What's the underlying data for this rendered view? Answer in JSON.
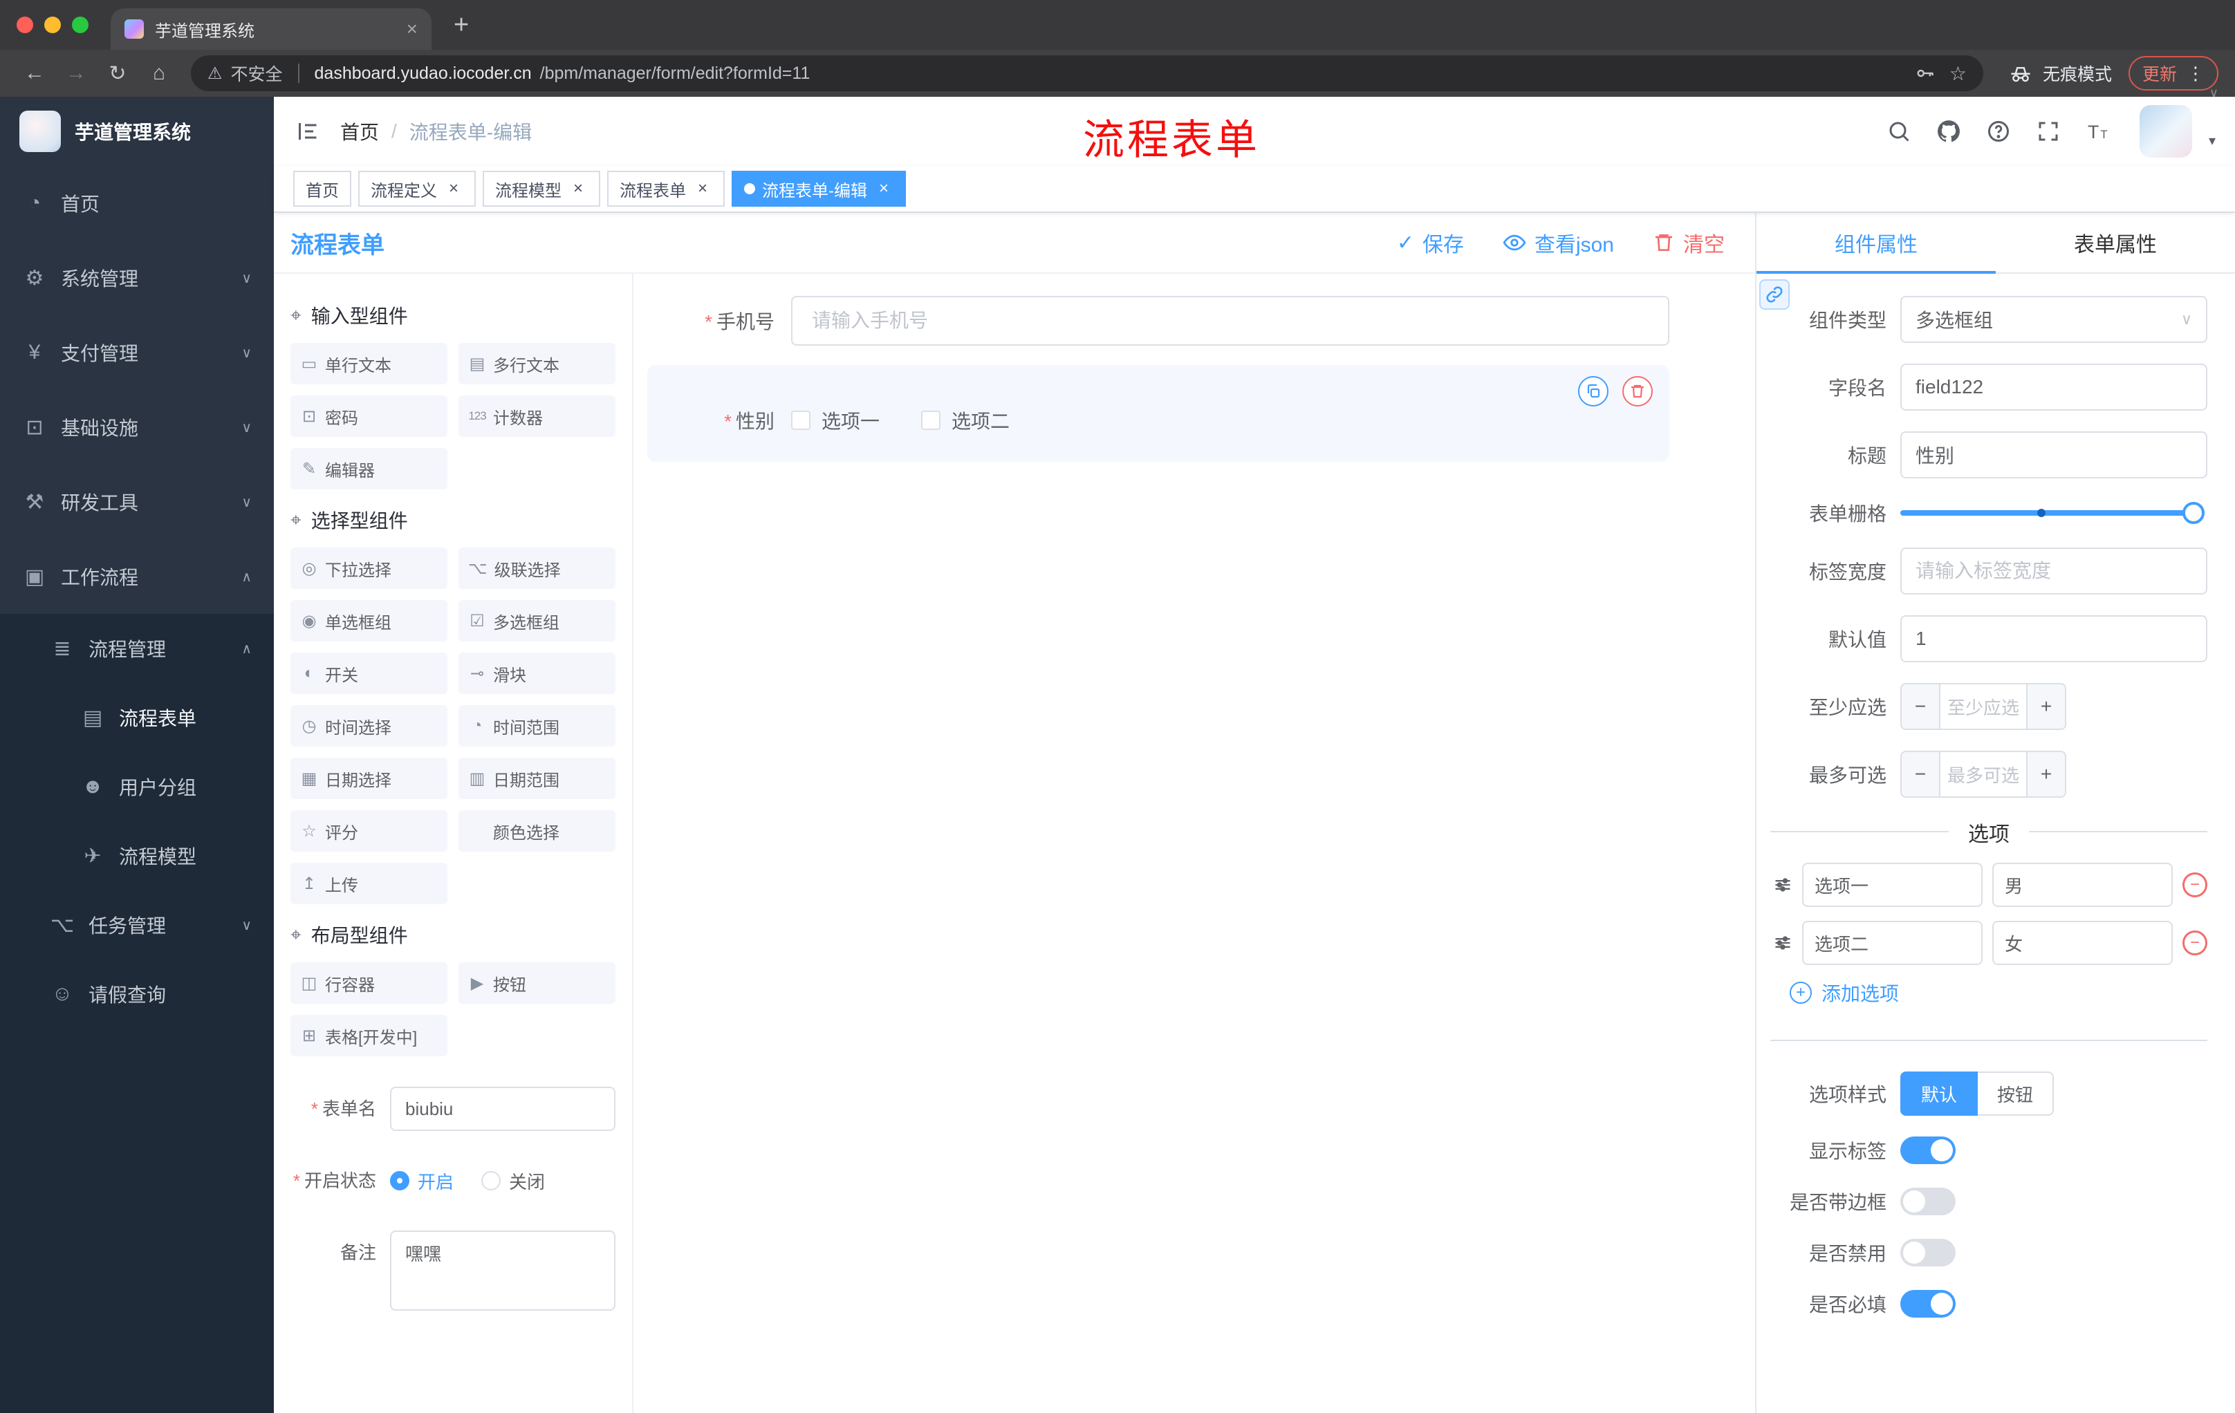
{
  "colors": {
    "accent": "#409eff",
    "danger": "#f56c6c",
    "annotation_red": "#f50f0f",
    "tag_active": "#409eff",
    "sidebar_bg": "#2a3442"
  },
  "misc": {
    "required_star": "*"
  },
  "icons": {
    "close": "×",
    "plus": "+",
    "back": "←",
    "forward": "→",
    "reload": "↻",
    "home": "⌂",
    "warning": "⚠",
    "star": "☆",
    "menu_dots": "⋮",
    "chevron_down": "∨",
    "chevron_up": "∧",
    "caret_down": "▾",
    "check": "✓",
    "minus": "−",
    "group_icon": "⌖"
  },
  "browser": {
    "tab": {
      "title": "芋道管理系统"
    },
    "security_label": "不安全",
    "url_domain": "dashboard.yudao.iocoder.cn",
    "url_path": "/bpm/manager/form/edit?formId=11",
    "incognito_label": "无痕模式",
    "update_label": "更新"
  },
  "sidebar": {
    "logo_title": "芋道管理系统",
    "items": [
      {
        "label": "首页",
        "glyph": "◔",
        "chevron": ""
      },
      {
        "label": "系统管理",
        "glyph": "⚙",
        "chevron": "∨"
      },
      {
        "label": "支付管理",
        "glyph": "¥",
        "chevron": "∨"
      },
      {
        "label": "基础设施",
        "glyph": "⊡",
        "chevron": "∨"
      },
      {
        "label": "研发工具",
        "glyph": "⚒",
        "chevron": "∨"
      },
      {
        "label": "工作流程",
        "glyph": "▣",
        "chevron": "∧"
      }
    ],
    "workflow": {
      "process_mgmt": {
        "label": "流程管理",
        "glyph": "≣",
        "chevron": "∧"
      },
      "children": [
        {
          "label": "流程表单",
          "glyph": "▤"
        },
        {
          "label": "用户分组",
          "glyph": "☻"
        },
        {
          "label": "流程模型",
          "glyph": "✈"
        }
      ],
      "task_mgmt": {
        "label": "任务管理",
        "glyph": "⌥",
        "chevron": "∨"
      },
      "leave_query": {
        "label": "请假查询",
        "glyph": "☺"
      }
    }
  },
  "header": {
    "breadcrumb": {
      "home": "首页",
      "separator": "/",
      "current": "流程表单-编辑"
    },
    "annotation": "流程表单"
  },
  "tags": [
    {
      "label": "首页"
    },
    {
      "label": "流程定义"
    },
    {
      "label": "流程模型"
    },
    {
      "label": "流程表单"
    },
    {
      "label": "流程表单-编辑"
    }
  ],
  "designer": {
    "title": "流程表单",
    "actions": {
      "save": "保存",
      "view_json": "查看json",
      "clear": "清空"
    },
    "palette": {
      "groups": [
        {
          "title": "输入型组件",
          "items": [
            {
              "label": "单行文本",
              "glyph": "▭"
            },
            {
              "label": "多行文本",
              "glyph": "▤"
            },
            {
              "label": "密码",
              "glyph": "⊡"
            },
            {
              "label": "计数器",
              "glyph": "123"
            },
            {
              "label": "编辑器",
              "glyph": "✎"
            }
          ]
        },
        {
          "title": "选择型组件",
          "items": [
            {
              "label": "下拉选择",
              "glyph": "◎"
            },
            {
              "label": "级联选择",
              "glyph": "⌥"
            },
            {
              "label": "单选框组",
              "glyph": "◉"
            },
            {
              "label": "多选框组",
              "glyph": "☑"
            },
            {
              "label": "开关",
              "glyph": "◐"
            },
            {
              "label": "滑块",
              "glyph": "⊸"
            },
            {
              "label": "时间选择",
              "glyph": "◷"
            },
            {
              "label": "时间范围",
              "glyph": "◔"
            },
            {
              "label": "日期选择",
              "glyph": "▦"
            },
            {
              "label": "日期范围",
              "glyph": "▥"
            },
            {
              "label": "评分",
              "glyph": "☆"
            },
            {
              "label": "颜色选择",
              "glyph": "⊚"
            },
            {
              "label": "上传",
              "glyph": "↥"
            }
          ]
        },
        {
          "title": "布局型组件",
          "items": [
            {
              "label": "行容器",
              "glyph": "◫"
            },
            {
              "label": "按钮",
              "glyph": "▶"
            },
            {
              "label": "表格[开发中]",
              "glyph": "⊞"
            }
          ]
        }
      ]
    },
    "meta": {
      "form_name": {
        "label": "表单名",
        "value": "biubiu"
      },
      "status": {
        "label": "开启状态",
        "on_label": "开启",
        "off_label": "关闭"
      },
      "remark": {
        "label": "备注",
        "value": "嘿嘿"
      }
    },
    "canvas": {
      "phone": {
        "label": "手机号",
        "placeholder": "请输入手机号"
      },
      "gender": {
        "label": "性别",
        "options": [
          {
            "label": "选项一"
          },
          {
            "label": "选项二"
          }
        ]
      }
    }
  },
  "props": {
    "tabs": {
      "component": "组件属性",
      "form": "表单属性"
    },
    "fields": {
      "component_type": {
        "label": "组件类型",
        "value": "多选框组"
      },
      "field_name": {
        "label": "字段名",
        "value": "field122"
      },
      "title": {
        "label": "标题",
        "value": "性别"
      },
      "grid": {
        "label": "表单栅格"
      },
      "label_width": {
        "label": "标签宽度",
        "placeholder": "请输入标签宽度"
      },
      "default_value": {
        "label": "默认值",
        "value": "1"
      },
      "min_select": {
        "label": "至少应选",
        "placeholder": "至少应选"
      },
      "max_select": {
        "label": "最多可选",
        "placeholder": "最多可选"
      }
    },
    "options_divider": "选项",
    "options": [
      {
        "label": "选项一",
        "value": "男"
      },
      {
        "label": "选项二",
        "value": "女"
      }
    ],
    "add_option": "添加选项",
    "option_style": {
      "label": "选项样式",
      "default": "默认",
      "button": "按钮"
    },
    "switches": [
      {
        "label": "显示标签",
        "on": true
      },
      {
        "label": "是否带边框",
        "on": false
      },
      {
        "label": "是否禁用",
        "on": false
      },
      {
        "label": "是否必填",
        "on": true
      }
    ]
  }
}
